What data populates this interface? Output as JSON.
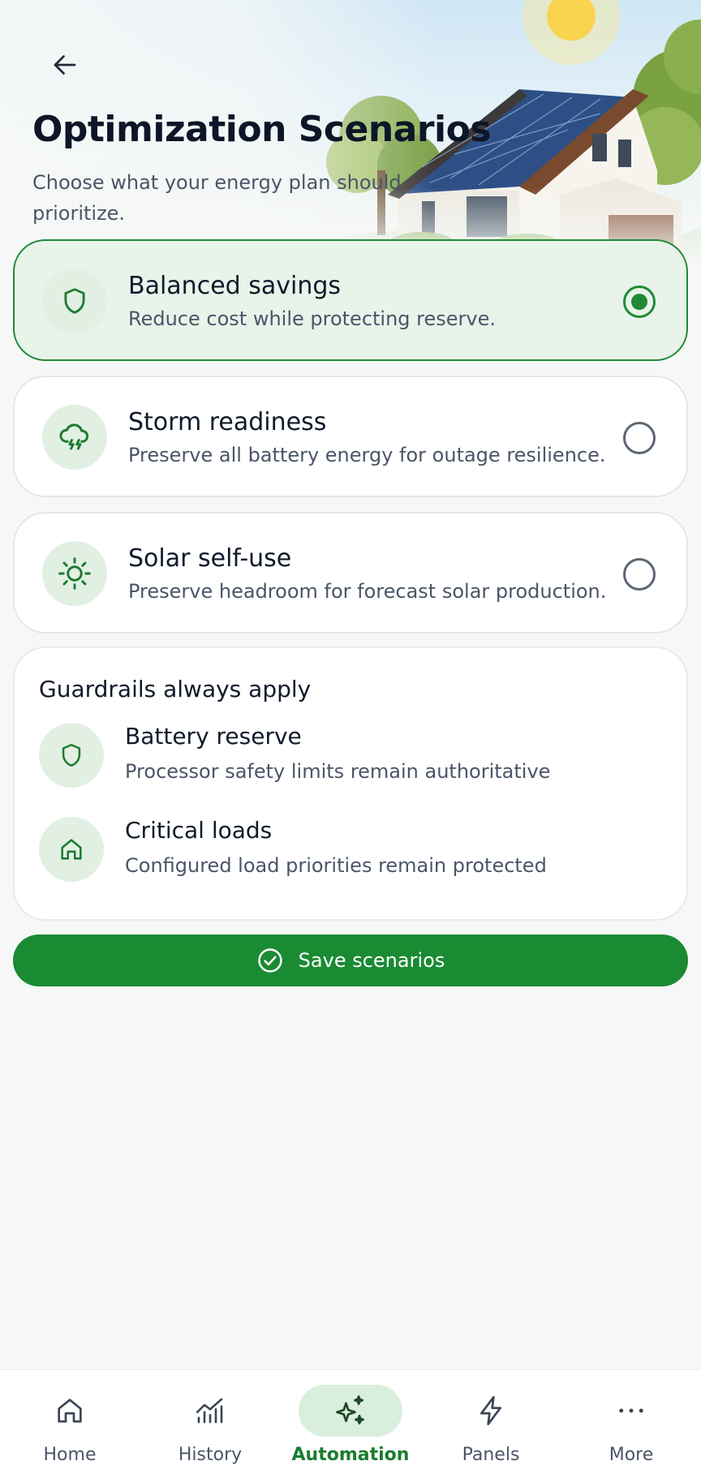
{
  "header": {
    "title": "Optimization Scenarios",
    "subtitle": "Choose what your energy plan should prioritize."
  },
  "scenarios": [
    {
      "title": "Balanced savings",
      "description": "Reduce cost while protecting reserve.",
      "icon": "shield-icon",
      "selected": true
    },
    {
      "title": "Storm readiness",
      "description": "Preserve all battery energy for outage resilience.",
      "icon": "storm-cloud-icon",
      "selected": false
    },
    {
      "title": "Solar self-use",
      "description": "Preserve headroom for forecast solar production.",
      "icon": "sun-icon",
      "selected": false
    }
  ],
  "guardrails": {
    "title": "Guardrails always apply",
    "items": [
      {
        "name": "Battery reserve",
        "description": "Processor safety limits remain authoritative",
        "icon": "shield-icon"
      },
      {
        "name": "Critical loads",
        "description": "Configured load priorities remain protected",
        "icon": "home-icon"
      }
    ]
  },
  "save_button": {
    "label": "Save scenarios",
    "icon": "check-circle-icon"
  },
  "nav": {
    "items": [
      {
        "label": "Home",
        "icon": "home-icon",
        "active": false
      },
      {
        "label": "History",
        "icon": "chart-icon",
        "active": false
      },
      {
        "label": "Automation",
        "icon": "sparkle-icon",
        "active": true
      },
      {
        "label": "Panels",
        "icon": "lightning-icon",
        "active": false
      },
      {
        "label": "More",
        "icon": "more-icon",
        "active": false
      }
    ]
  },
  "colors": {
    "accent": "#1a8a33",
    "selected_bg": "#e8f3ea",
    "icon_bg": "#e1f0e3",
    "text_primary": "#0f1a2a",
    "text_secondary": "#4a5568"
  }
}
